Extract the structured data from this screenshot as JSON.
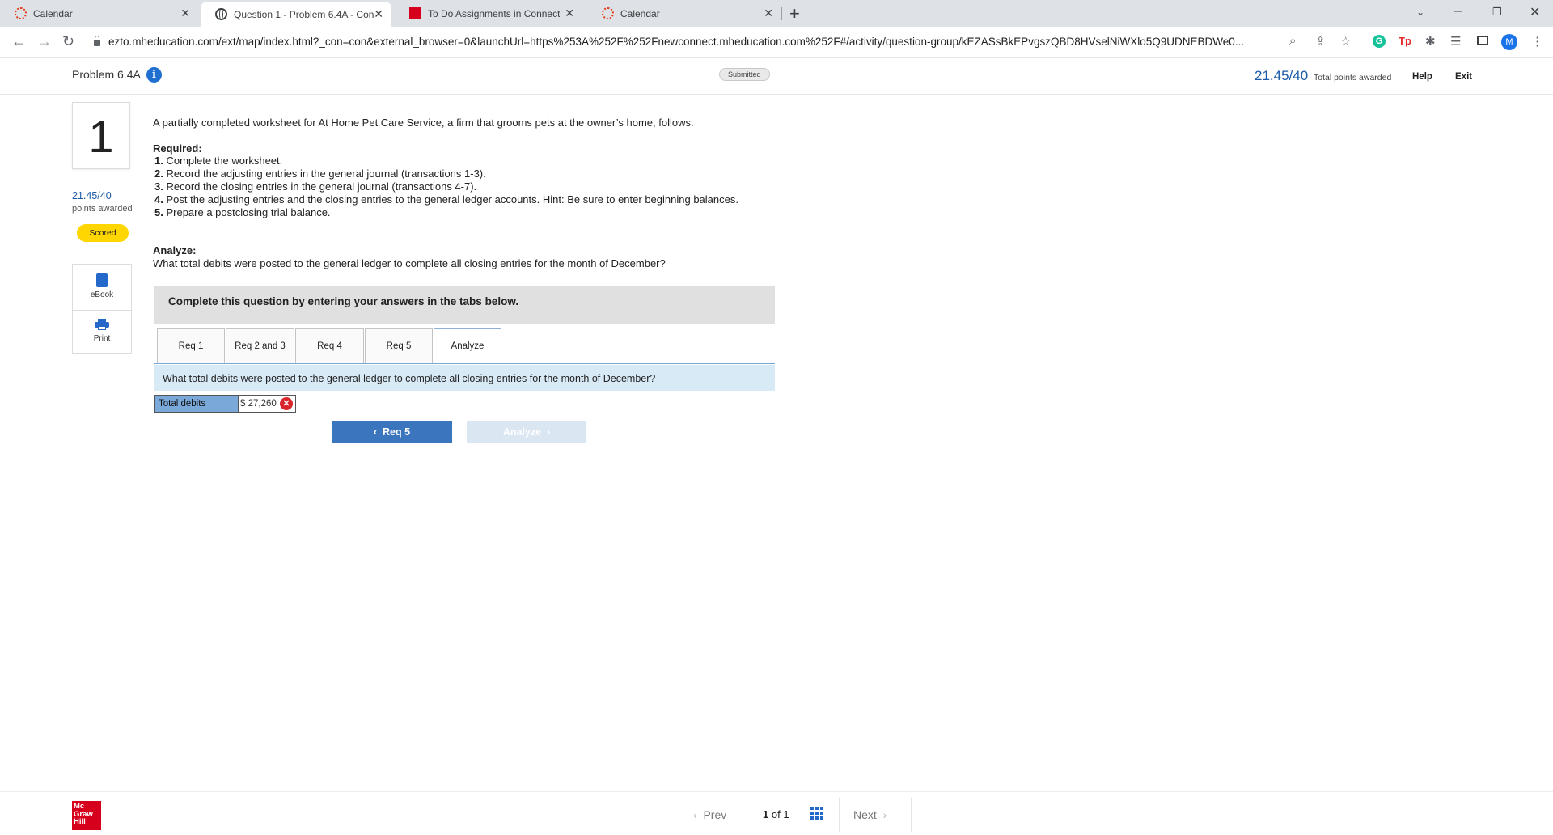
{
  "browser": {
    "tabs": [
      {
        "label": "Calendar",
        "icon": "calendar-icon"
      },
      {
        "label": "Question 1 - Problem 6.4A - Con",
        "icon": "globe-icon"
      },
      {
        "label": "To Do Assignments in Connect",
        "icon": "mcgraw-hill-icon"
      },
      {
        "label": "Calendar",
        "icon": "calendar-icon"
      }
    ],
    "url": "ezto.mheducation.com/ext/map/index.html?_con=con&external_browser=0&launchUrl=https%253A%252F%252Fnewconnect.mheducation.com%252F#/activity/question-group/kEZASsBkEPvgszQBD8HVselNiWXlo5Q9UDNEBDWe0...",
    "profile_initial": "M"
  },
  "header": {
    "problem_title": "Problem 6.4A",
    "status": "Submitted",
    "score": "21.45/40",
    "score_label": "Total points awarded",
    "help": "Help",
    "exit": "Exit"
  },
  "sidebar": {
    "question_number": "1",
    "points": "21.45/40",
    "points_label": "points awarded",
    "badge": "Scored",
    "ebook": "eBook",
    "print": "Print"
  },
  "question": {
    "intro": "A partially completed worksheet for At Home Pet Care Service, a firm that grooms pets at the owner’s home, follows.",
    "required_heading": "Required:",
    "requirements": [
      {
        "num": "1.",
        "text": "Complete the worksheet."
      },
      {
        "num": "2.",
        "text": "Record the adjusting entries in the general journal (transactions 1-3)."
      },
      {
        "num": "3.",
        "text": "Record the closing entries in the general journal (transactions 4-7)."
      },
      {
        "num": "4.",
        "text": "Post the adjusting entries and the closing entries to the general ledger accounts. Hint: Be sure to enter beginning balances."
      },
      {
        "num": "5.",
        "text": "Prepare a postclosing trial balance."
      }
    ],
    "analyze_heading": "Analyze:",
    "analyze_text": "What total debits were posted to the general ledger to complete all closing entries for the month of December?"
  },
  "panel": {
    "instruction": "Complete this question by entering your answers in the tabs below.",
    "tabs": [
      "Req 1",
      "Req 2 and 3",
      "Req 4",
      "Req 5",
      "Analyze"
    ],
    "active_tab": "Analyze",
    "question": "What total debits were posted to the general ledger to complete all closing entries for the month of December?",
    "answer_label": "Total debits",
    "answer_value": "$ 27,260",
    "answer_correct": false,
    "prev_button": "Req 5",
    "next_button": "Analyze"
  },
  "footer": {
    "logo": [
      "Mc",
      "Graw",
      "Hill"
    ],
    "prev": "Prev",
    "page_current": "1",
    "page_of": "of",
    "page_total": "1",
    "next": "Next"
  },
  "colors": {
    "accent": "#3b75bd",
    "score_blue": "#1b5aa6",
    "badge_yellow": "#ffd600",
    "error_red": "#d9262c",
    "brand_red": "#d6001c"
  }
}
